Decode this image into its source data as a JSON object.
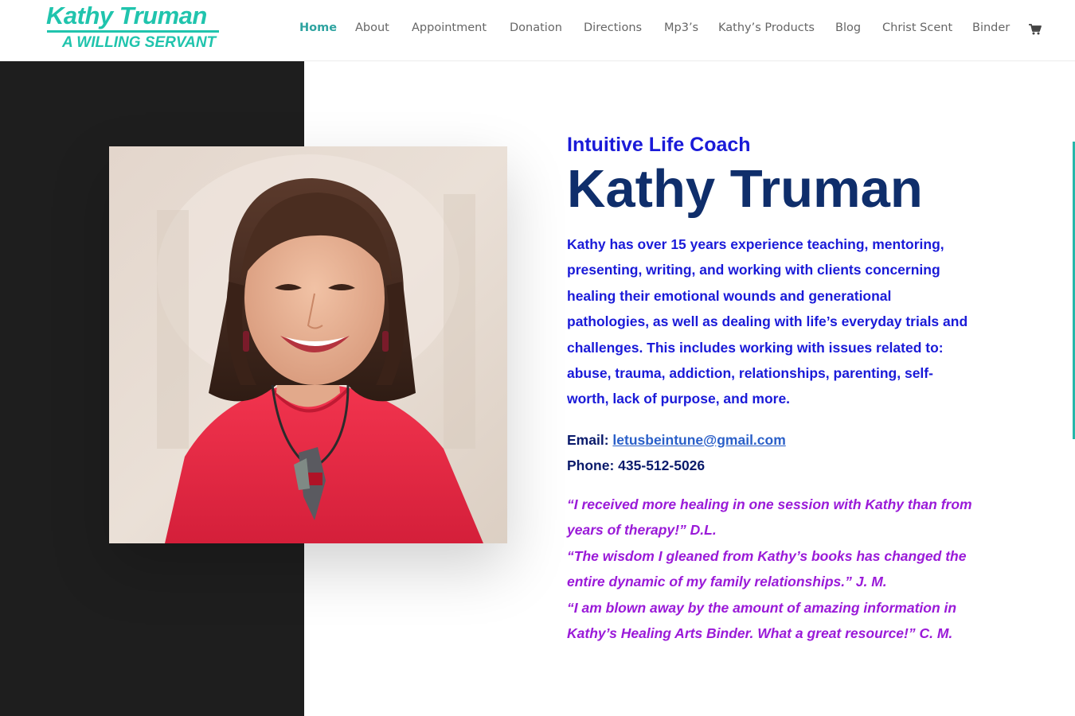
{
  "header": {
    "logo_line1": "Kathy Truman",
    "logo_line2": "A WILLING SERVANT",
    "nav": [
      {
        "label": "Home",
        "active": true
      },
      {
        "label": "About"
      },
      {
        "label": "Appointment"
      },
      {
        "label": "Donation"
      },
      {
        "label": "Directions"
      },
      {
        "label": "Mp3’s"
      },
      {
        "label": "Kathy’s Products"
      },
      {
        "label": "Blog"
      },
      {
        "label": "Christ Scent"
      },
      {
        "label": "Binder"
      }
    ],
    "cart_icon": "shopping-cart-icon"
  },
  "hero": {
    "subtitle": "Intuitive Life Coach",
    "name": "Kathy Truman",
    "bio": "Kathy has over 15 years experience teaching, mentoring, presenting, writing, and working with clients concerning healing their emotional wounds and generational pathologies, as well as dealing with life’s everyday trials and challenges. This includes working with issues related to: abuse, trauma, addiction, relationships, parenting, self-worth, lack of purpose, and more.",
    "email_label": "Email:",
    "email": "letusbeintune@gmail.com",
    "phone": "Phone: 435-512-5026",
    "quotes": [
      "“I received more healing in one session with Kathy than from years of therapy!” D.L.",
      "“The wisdom I gleaned from Kathy’s books has changed the entire dynamic of my family relationships.” J. M.",
      "“I am blown away by the amount of amazing information in Kathy’s Healing Arts Binder. What a great resource!” C. M."
    ]
  },
  "colors": {
    "brand_teal": "#20c4ad",
    "nav_active": "#2ea3a0",
    "heading_blue": "#1a1ad8",
    "name_navy": "#0f2e6b",
    "quote_purple": "#9a1ad8",
    "panel_dark": "#1e1e1e"
  }
}
